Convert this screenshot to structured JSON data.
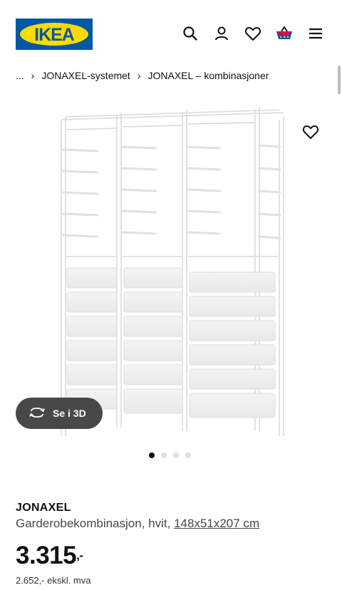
{
  "header": {
    "logo_text": "IKEA",
    "icons": [
      "search-icon",
      "user-icon",
      "heart-icon",
      "cart-icon",
      "menu-icon"
    ]
  },
  "breadcrumb": {
    "items": [
      "...",
      "JONAXEL-systemet",
      "JONAXEL – kombinasjoner"
    ]
  },
  "gallery": {
    "button_3d_label": "Se i 3D",
    "dots_total": 4,
    "active_dot": 1
  },
  "product": {
    "name": "JONAXEL",
    "description": "Garderobekombinasjon, hvit,",
    "dimensions": "148x51x207 cm",
    "price_main": "3.315",
    "price_suffix": ",-",
    "price_ex_vat": "2.652,- ekskl. mva"
  },
  "colors": {
    "ikea_blue": "#0058a3",
    "ikea_yellow": "#ffdb00",
    "pill_bg": "#484848"
  }
}
